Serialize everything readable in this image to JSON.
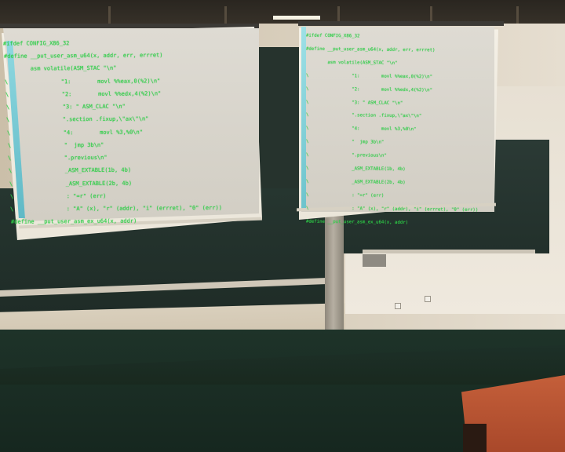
{
  "screens": {
    "left": {
      "lines": [
        "#ifdef CONFIG_X86_32",
        "#define __put_user_asm_u64(x, addr, err, errret)",
        "        asm volatile(ASM_STAC \"\\n\"",
        "\\                \"1:        movl %%eax,0(%2)\\n\"",
        "\\                \"2:        movl %%edx,4(%2)\\n\"",
        "\\                \"3: \" ASM_CLAC \"\\n\"",
        "\\                \".section .fixup,\\\"ax\\\"\\n\"",
        "\\                \"4:        movl %3,%0\\n\"",
        "\\                \"  jmp 3b\\n\"",
        "\\                \".previous\\n\"",
        "\\                _ASM_EXTABLE(1b, 4b)",
        "\\                _ASM_EXTABLE(2b, 4b)",
        "\\                : \"=r\" (err)",
        "\\                : \"A\" (x), \"r\" (addr), \"i\" (errret), \"0\" (err))",
        "#define __put_user_asm_ex_u64(x, addr)"
      ]
    },
    "right": {
      "lines": [
        "#ifdef CONFIG_X86_32",
        "#define __put_user_asm_u64(x, addr, err, errret)",
        "        asm volatile(ASM_STAC \"\\n\"",
        "\\                \"1:        movl %%eax,0(%2)\\n\"",
        "\\                \"2:        movl %%edx,4(%2)\\n\"",
        "\\                \"3: \" ASM_CLAC \"\\n\"",
        "\\                \".section .fixup,\\\"ax\\\"\\n\"",
        "\\                \"4:        movl %3,%0\\n\"",
        "\\                \"  jmp 3b\\n\"",
        "\\                \".previous\\n\"",
        "\\                _ASM_EXTABLE(1b, 4b)",
        "\\                _ASM_EXTABLE(2b, 4b)",
        "\\                : \"=r\" (err)",
        "\\                : \"A\" (x), \"r\" (addr), \"i\" (errret), \"0\" (err))",
        "#define __put_user_asm_ex_u64(x, addr)"
      ]
    }
  },
  "colors": {
    "code_text": "#2fd34a",
    "screen_surface": "#ebe6da",
    "chalkboard": "#243028",
    "floor": "#1e3329",
    "desk": "#c45f3a"
  }
}
